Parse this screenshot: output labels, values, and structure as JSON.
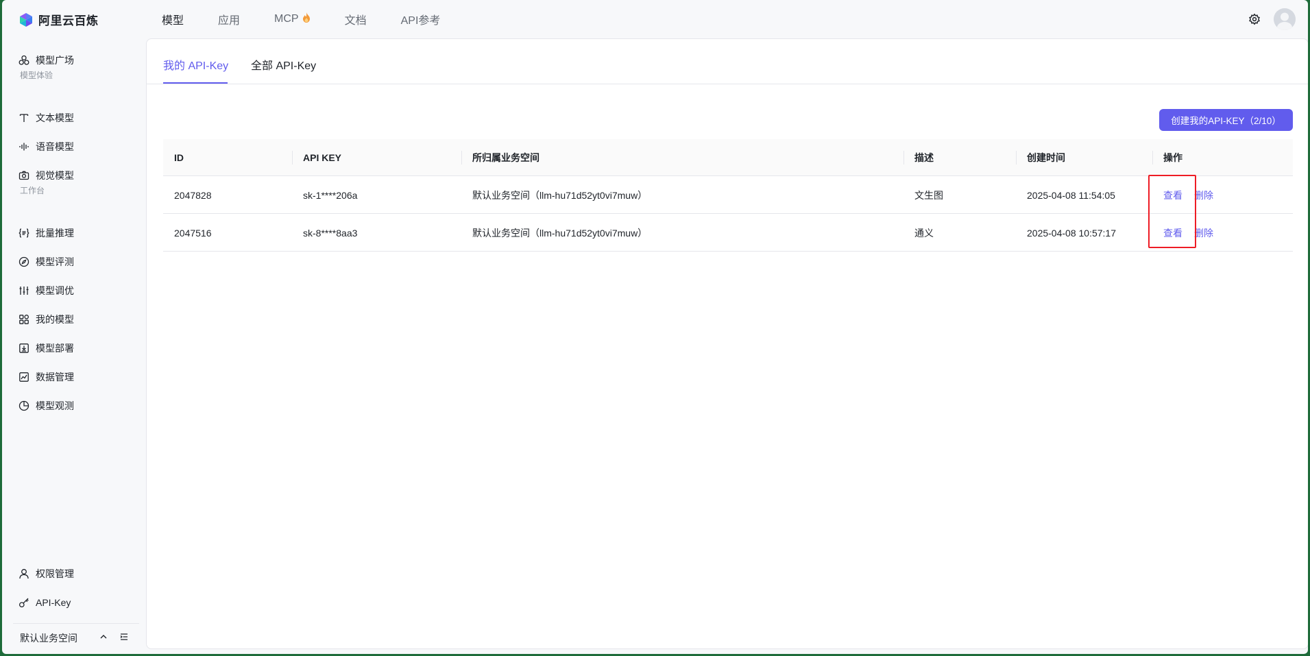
{
  "app": {
    "logo_text": "阿里云百炼"
  },
  "topnav": {
    "items": [
      {
        "label": "模型"
      },
      {
        "label": "应用"
      },
      {
        "label": "MCP"
      },
      {
        "label": "文档"
      },
      {
        "label": "API参考"
      }
    ],
    "active_index": 0
  },
  "sidebar": {
    "model_square": "模型广场",
    "group_experience": "模型体验",
    "text_model": "文本模型",
    "voice_model": "语音模型",
    "vision_model": "视觉模型",
    "group_workbench": "工作台",
    "batch_inference": "批量推理",
    "model_eval": "模型评测",
    "model_tuning": "模型调优",
    "my_models": "我的模型",
    "model_deploy": "模型部署",
    "data_manage": "数据管理",
    "model_observe": "模型观测",
    "permission": "权限管理",
    "api_key": "API-Key",
    "workspace": "默认业务空间"
  },
  "tabs": {
    "my_api_key": "我的 API-Key",
    "all_api_key": "全部 API-Key"
  },
  "create_button": "创建我的API-KEY（2/10）",
  "table": {
    "headers": {
      "id": "ID",
      "api_key": "API KEY",
      "workspace": "所归属业务空间",
      "desc": "描述",
      "created": "创建时间",
      "action": "操作"
    },
    "rows": [
      {
        "id": "2047828",
        "api_key": "sk-1****206a",
        "workspace": "默认业务空间（llm-hu71d52yt0vi7muw）",
        "desc": "文生图",
        "created": "2025-04-08 11:54:05",
        "view": "查看",
        "delete": "删除"
      },
      {
        "id": "2047516",
        "api_key": "sk-8****8aa3",
        "workspace": "默认业务空间（llm-hu71d52yt0vi7muw）",
        "desc": "通义",
        "created": "2025-04-08 10:57:17",
        "view": "查看",
        "delete": "删除"
      }
    ]
  },
  "colors": {
    "accent": "#615ced",
    "highlight_box": "#ee1c25",
    "outer_border": "#1e6b3a"
  }
}
